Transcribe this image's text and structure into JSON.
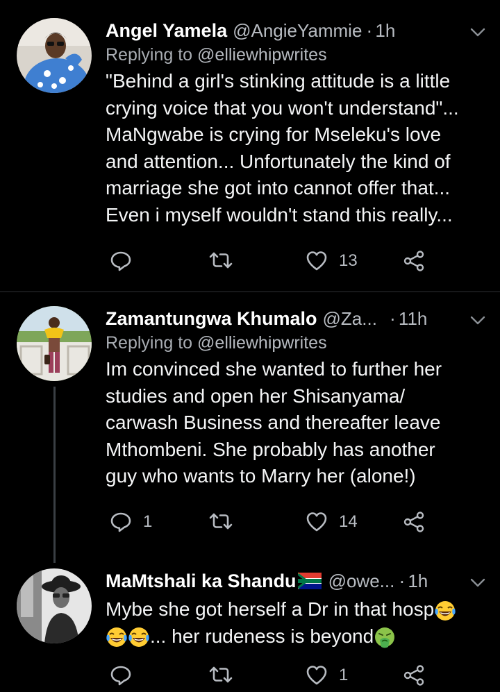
{
  "tweets": [
    {
      "name": "Angel Yamela",
      "handle": "@AngieYammie",
      "time": "1h",
      "replying_prefix": "Replying to ",
      "replying_to": "@elliewhipwrites",
      "lines": [
        "\"Behind a girl's stinking attitude is a little",
        "crying voice that you won't understand\"...",
        "MaNgwabe is crying for Mseleku's love",
        "and attention... Unfortunately the kind of",
        "marriage she got into cannot offer that...",
        "Even i myself wouldn't stand this really..."
      ],
      "reply_count": "",
      "retweet_count": "",
      "like_count": "13"
    },
    {
      "name": "Zamantungwa Khumalo",
      "handle": "@Za...",
      "time": "11h",
      "replying_prefix": "Replying to ",
      "replying_to": "@elliewhipwrites",
      "lines": [
        "Im convinced she wanted to further her",
        "studies and open her Shisanyama/",
        "carwash Business and thereafter leave",
        "Mthombeni. She probably has another",
        "guy who wants to Marry her (alone!)"
      ],
      "reply_count": "1",
      "retweet_count": "",
      "like_count": "14"
    },
    {
      "name": "MaMtshali ka Shandu",
      "handle": "@owe...",
      "time": "1h",
      "line1": "Mybe she got herself a Dr in that hosp",
      "line2": "... her rudeness is beyond",
      "reply_count": "",
      "retweet_count": "",
      "like_count": "1"
    }
  ],
  "icons": {
    "reply": "reply-icon",
    "retweet": "retweet-icon",
    "like": "heart-icon",
    "share": "share-icon",
    "menu": "chevron-down-icon",
    "flag": "south-africa-flag-emoji",
    "laugh": "tears-of-joy-emoji",
    "sick": "vomiting-face-emoji"
  },
  "colors": {
    "background": "#000000",
    "text": "#e7e9ea",
    "secondary": "#b8bcc2",
    "divider": "#2f3336"
  }
}
